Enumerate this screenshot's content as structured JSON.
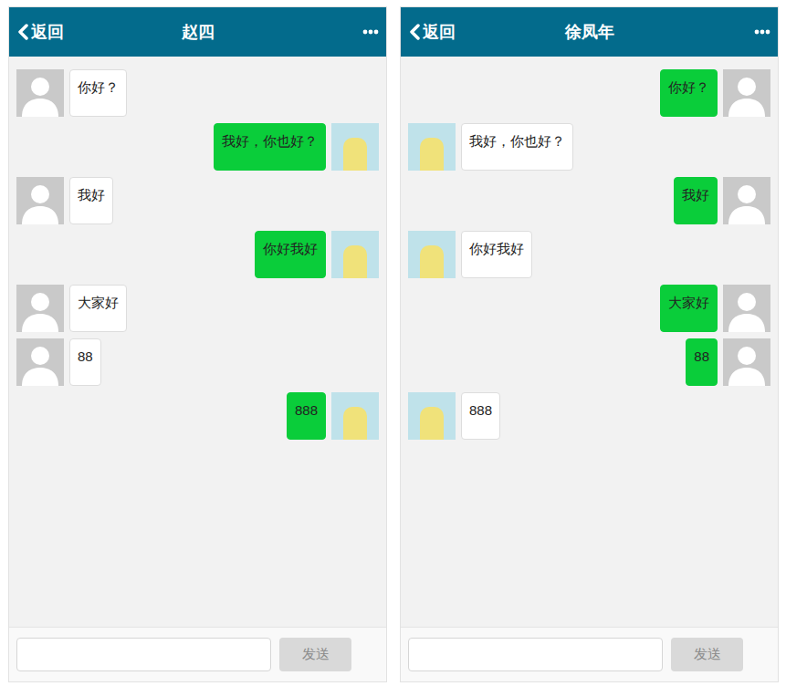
{
  "chats": [
    {
      "header": {
        "back": "返回",
        "title": "赵四"
      },
      "messages": [
        {
          "text": "你好？",
          "kind": "received"
        },
        {
          "text": "我好，你也好？",
          "kind": "sent"
        },
        {
          "text": "我好",
          "kind": "received"
        },
        {
          "text": "你好我好",
          "kind": "sent"
        },
        {
          "text": "大家好",
          "kind": "received"
        },
        {
          "text": "88",
          "kind": "received"
        },
        {
          "text": "888",
          "kind": "sent"
        }
      ],
      "composer": {
        "send": {
          "label": "发送",
          "disabled": true
        }
      }
    },
    {
      "header": {
        "back": "返回",
        "title": "徐凤年"
      },
      "messages": [
        {
          "text": "你好？",
          "kind": "sent"
        },
        {
          "text": "我好，你也好？",
          "kind": "received"
        },
        {
          "text": "我好",
          "kind": "sent"
        },
        {
          "text": "你好我好",
          "kind": "received"
        },
        {
          "text": "大家好",
          "kind": "sent"
        },
        {
          "text": "88",
          "kind": "sent"
        },
        {
          "text": "888",
          "kind": "received"
        }
      ],
      "composer": {
        "send": {
          "label": "发送",
          "disabled": true
        }
      }
    }
  ]
}
